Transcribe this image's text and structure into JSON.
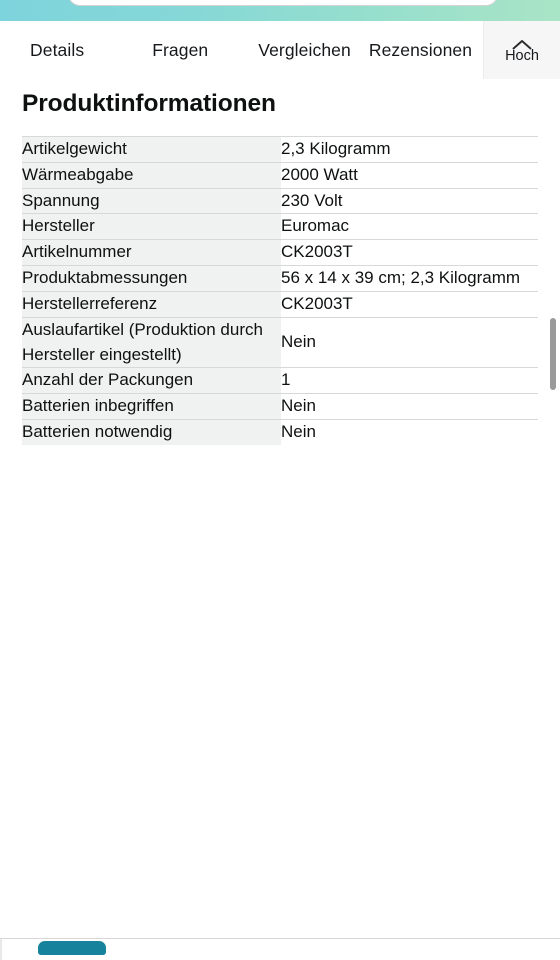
{
  "browser": {
    "top_gradient_left_color": "#7ed4dd",
    "top_gradient_right_color": "#a9e4c6",
    "bottom_tab_color": "#17829b"
  },
  "navbar": {
    "tabs": [
      {
        "label": "Details"
      },
      {
        "label": "Fragen"
      },
      {
        "label": "Vergleichen"
      },
      {
        "label": "Rezensionen"
      }
    ],
    "top_button": {
      "icon": "chevron-up-icon",
      "label": "Hoch"
    }
  },
  "main": {
    "section_title": "Produktinformationen",
    "spec_rows": [
      {
        "key": "Artikelgewicht",
        "value": "2,3 Kilogramm"
      },
      {
        "key": "Wärmeabgabe",
        "value": "2000 Watt"
      },
      {
        "key": "Spannung",
        "value": "230 Volt"
      },
      {
        "key": "Hersteller",
        "value": "Euromac"
      },
      {
        "key": "Artikelnummer",
        "value": "CK2003T"
      },
      {
        "key": "Produktabmessungen",
        "value": "56 x 14 x 39 cm; 2,3 Kilogramm"
      },
      {
        "key": "Herstellerreferenz",
        "value": "CK2003T"
      },
      {
        "key": "Auslaufartikel (Produktion durch Hersteller eingestellt)",
        "value": "Nein"
      },
      {
        "key": "Anzahl der Packungen",
        "value": "1"
      },
      {
        "key": "Batterien inbegriffen",
        "value": "Nein"
      },
      {
        "key": "Batterien notwendig",
        "value": "Nein"
      }
    ]
  },
  "scrollbar": {
    "name": "page-scrollbar"
  }
}
